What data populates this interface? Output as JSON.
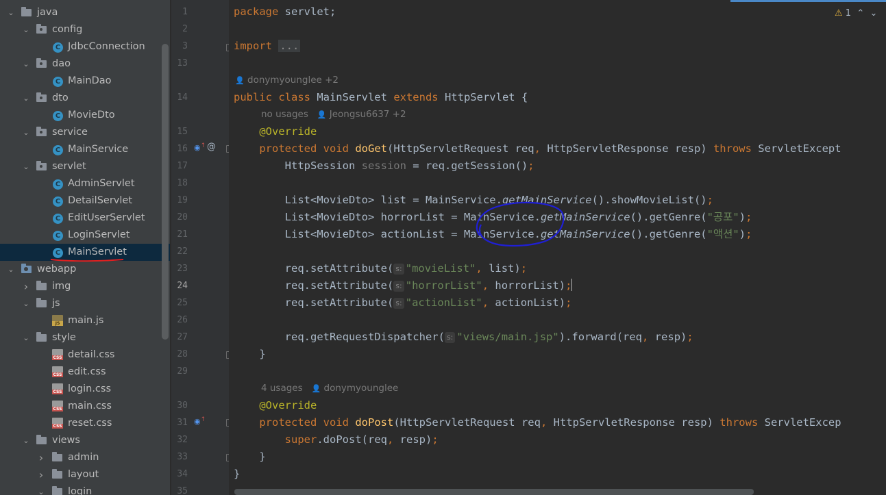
{
  "project_tree": {
    "items": [
      {
        "label": "java",
        "depth": 0,
        "expanded": true,
        "icon": "folder-icon"
      },
      {
        "label": "config",
        "depth": 1,
        "expanded": true,
        "icon": "package-icon"
      },
      {
        "label": "JdbcConnection",
        "depth": 2,
        "icon": "class-icon"
      },
      {
        "label": "dao",
        "depth": 1,
        "expanded": true,
        "icon": "package-icon"
      },
      {
        "label": "MainDao",
        "depth": 2,
        "icon": "class-icon"
      },
      {
        "label": "dto",
        "depth": 1,
        "expanded": true,
        "icon": "package-icon"
      },
      {
        "label": "MovieDto",
        "depth": 2,
        "icon": "class-icon"
      },
      {
        "label": "service",
        "depth": 1,
        "expanded": true,
        "icon": "package-icon"
      },
      {
        "label": "MainService",
        "depth": 2,
        "icon": "class-icon"
      },
      {
        "label": "servlet",
        "depth": 1,
        "expanded": true,
        "icon": "package-icon"
      },
      {
        "label": "AdminServlet",
        "depth": 2,
        "icon": "class-icon"
      },
      {
        "label": "DetailServlet",
        "depth": 2,
        "icon": "class-icon"
      },
      {
        "label": "EditUserServlet",
        "depth": 2,
        "icon": "class-icon"
      },
      {
        "label": "LoginServlet",
        "depth": 2,
        "icon": "class-icon"
      },
      {
        "label": "MainServlet",
        "depth": 2,
        "icon": "class-icon",
        "selected": true
      },
      {
        "label": "webapp",
        "depth": 0,
        "expanded": true,
        "icon": "web-folder-icon"
      },
      {
        "label": "img",
        "depth": 1,
        "expanded": false,
        "icon": "folder-icon"
      },
      {
        "label": "js",
        "depth": 1,
        "expanded": true,
        "icon": "folder-icon"
      },
      {
        "label": "main.js",
        "depth": 2,
        "icon": "js-file-icon"
      },
      {
        "label": "style",
        "depth": 1,
        "expanded": true,
        "icon": "folder-icon"
      },
      {
        "label": "detail.css",
        "depth": 2,
        "icon": "css-file-icon"
      },
      {
        "label": "edit.css",
        "depth": 2,
        "icon": "css-file-icon"
      },
      {
        "label": "login.css",
        "depth": 2,
        "icon": "css-file-icon"
      },
      {
        "label": "main.css",
        "depth": 2,
        "icon": "css-file-icon"
      },
      {
        "label": "reset.css",
        "depth": 2,
        "icon": "css-file-icon"
      },
      {
        "label": "views",
        "depth": 1,
        "expanded": true,
        "icon": "folder-icon"
      },
      {
        "label": "admin",
        "depth": 2,
        "expanded": false,
        "icon": "folder-icon"
      },
      {
        "label": "layout",
        "depth": 2,
        "expanded": false,
        "icon": "folder-icon"
      },
      {
        "label": "login",
        "depth": 2,
        "expanded": true,
        "icon": "folder-icon"
      }
    ]
  },
  "editor": {
    "warnings": {
      "count": "1"
    },
    "line_numbers": [
      "1",
      "2",
      "3",
      "13",
      "",
      "14",
      "",
      "15",
      "16",
      "17",
      "18",
      "19",
      "20",
      "21",
      "22",
      "23",
      "24",
      "25",
      "26",
      "27",
      "28",
      "29",
      "",
      "30",
      "31",
      "32",
      "33",
      "34",
      "35"
    ],
    "current_line": "24",
    "authors": {
      "class": "donymyounglee +2",
      "doget_usages": "no usages",
      "doget_author": "Jeongsu6637 +2",
      "dopost_usages": "4 usages",
      "dopost_author": "donymyounglee"
    },
    "code": {
      "package_kw": "package",
      "package_name": " servlet;",
      "import_kw": "import",
      "import_fold": "...",
      "public_class": "public class",
      "class_name": " MainServlet ",
      "extends_kw": "extends",
      "class_rest": " HttpServlet {",
      "override": "@Override",
      "protected_void": "protected void",
      "doget": "doGet",
      "doget_params_a": "(HttpServletRequest req",
      "comma": ",",
      "doget_params_b": " HttpServletResponse resp) ",
      "throws": "throws",
      "doget_exc": " ServletExcept",
      "l17_a": "HttpSession ",
      "l17_var": "session",
      "l17_b": " = req.getSession()",
      "semi": ";",
      "l19_a": "List<MovieDto> list = MainService.",
      "get_main_service": "getMainService",
      "l19_b": "().showMovieList()",
      "l20_a": "List<MovieDto> horrorList = MainService.",
      "get_genre": "().getGenre(",
      "genre_horror": "\"공포\"",
      "close": ")",
      "l21_a": "List<MovieDto> actionList = MainService.",
      "genre_action": "\"액션\"",
      "set_attr": "req.setAttribute(",
      "hint_s": "s:",
      "l23_str": "\"movieList\"",
      "l23_var": " list",
      "l24_str": "\"horrorList\"",
      "l24_var": " horrorList",
      "l25_str": "\"actionList\"",
      "l25_var": " actionList",
      "l27_a": "req.getRequestDispatcher(",
      "l27_str": "\"views/main.jsp\"",
      "l27_b": ").forward(req",
      "l27_c": " resp)",
      "brace_close": "}",
      "dopost": "doPost",
      "dopost_exc": " ServletExcep",
      "super_kw": "super",
      "super_rest": ".doPost(req",
      "super_end": " resp)"
    }
  },
  "colors": {
    "keyword": "#cc7832",
    "string": "#6a8759",
    "annotation": "#bbb529",
    "function": "#ffc66d",
    "selection": "#0d293e"
  }
}
